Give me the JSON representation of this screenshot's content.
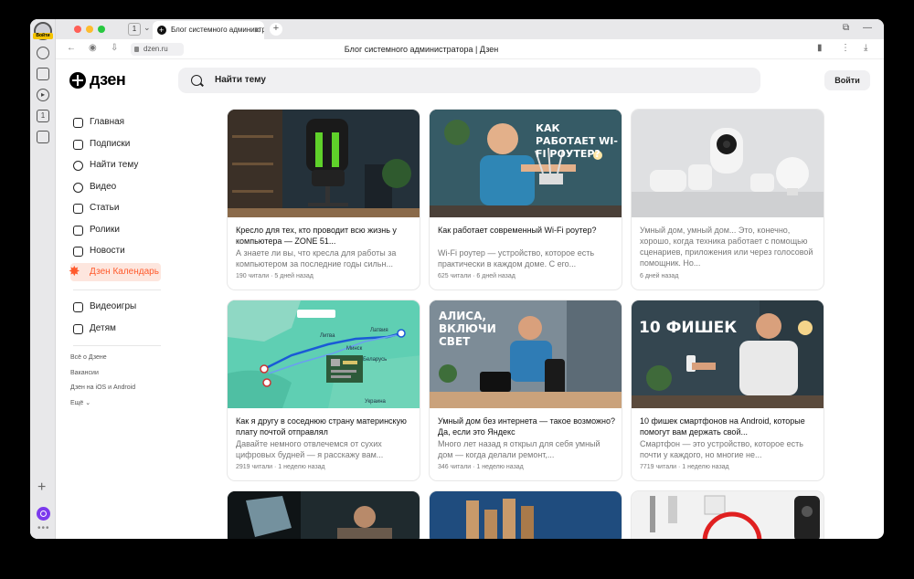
{
  "browser": {
    "tab_count": "1",
    "tab_title": "Блог системного администратора",
    "profile_badge": "Войти",
    "url": "dzen.ru",
    "page_title": "Блог системного администратора | Дзен"
  },
  "header": {
    "logo": "дзен",
    "search_placeholder": "Найти тему",
    "login": "Войти"
  },
  "nav": {
    "items": [
      "Главная",
      "Подписки",
      "Найти тему",
      "Видео",
      "Статьи",
      "Ролики",
      "Новости",
      "Дзен Календарь"
    ],
    "extra": [
      "Видеоигры",
      "Детям"
    ],
    "footer": [
      "Всё о Дзене",
      "Вакансии",
      "Дзен на iOS и Android",
      "Ещё"
    ]
  },
  "cards": [
    {
      "title": "Кресло для тех, кто проводит всю жизнь у компьютера — ZONE 51...",
      "desc": "А знаете ли вы, что кресла для работы за компьютером за последние годы сильн...",
      "meta": "190 читали · 5 дней назад"
    },
    {
      "title": "Как работает современный Wi-Fi роутер?",
      "desc": "Wi-Fi роутер — устройство, которое есть практически в каждом доме. С его...",
      "meta": "625 читали · 6 дней назад",
      "overlay": "КАК РАБОТАЕТ WI-FI РОУТЕР?"
    },
    {
      "title": "",
      "desc": "Умный дом, умный дом... Это, конечно, хорошо, когда техника работает с помощью сценариев, приложения или через голосовой помощник. Но...",
      "meta": "6 дней назад"
    },
    {
      "title": "Как я другу в соседнюю страну материнскую плату почтой отправлял",
      "desc": "Давайте немного отвлечемся от сухих цифровых будней — я расскажу вам...",
      "meta": "2919 читали · 1 неделю назад",
      "map_labels": [
        "Литва",
        "Латвия",
        "Минск",
        "Беларусь",
        "Украина"
      ]
    },
    {
      "title": "Умный дом без интернета — такое возможно? Да, если это Яндекс",
      "desc": "Много лет назад я открыл для себя умный дом — когда делали ремонт,...",
      "meta": "346 читали · 1 неделю назад",
      "overlay": "АЛИСА, ВКЛЮЧИ СВЕТ"
    },
    {
      "title": "10 фишек смартфонов на Android, которые помогут вам держать свой...",
      "desc": "Смартфон — это устройство, которое есть почти у каждого, но многие не...",
      "meta": "7719 читали · 1 неделю назад",
      "overlay": "10 ФИШЕК"
    }
  ]
}
